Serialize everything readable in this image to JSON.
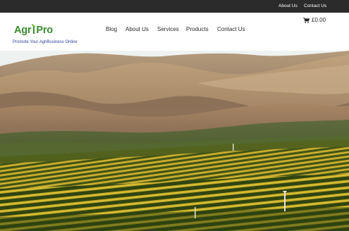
{
  "topbar": {
    "about_label": "About Us",
    "contact_label": "Contact Us"
  },
  "brand": {
    "name_left": "Agr",
    "name_right": "Pro",
    "tagline": "Promote Your AgriBusiness Online"
  },
  "nav": {
    "items": [
      "Blog",
      "About Us",
      "Services",
      "Products",
      "Contact Us"
    ]
  },
  "cart": {
    "icon": "cart-icon",
    "total": "£0.00"
  },
  "hero": {
    "image": "vineyard-hills"
  },
  "colors": {
    "topbar": "#2b2b2b",
    "brand_green": "#3a8a2e",
    "leaf_green": "#7cc242",
    "tagline_blue": "#2f3e9e"
  }
}
